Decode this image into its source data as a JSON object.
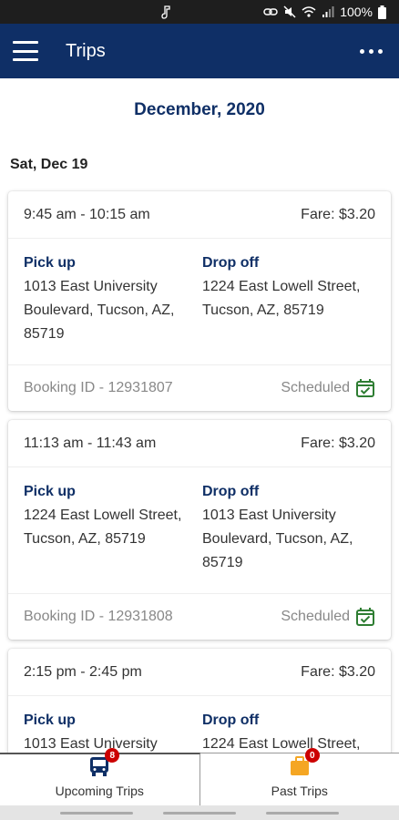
{
  "status_bar": {
    "battery": "100%"
  },
  "app_bar": {
    "title": "Trips"
  },
  "month": "December, 2020",
  "day": "Sat, Dec 19",
  "trips": [
    {
      "time": "9:45 am - 10:15 am",
      "fare": "Fare: $3.20",
      "pickup_label": "Pick up",
      "pickup_address": "1013 East University Boulevard, Tucson, AZ, 85719",
      "dropoff_label": "Drop off",
      "dropoff_address": "1224 East Lowell Street, Tucson, AZ, 85719",
      "booking": "Booking ID - 12931807",
      "status": "Scheduled"
    },
    {
      "time": "11:13 am - 11:43 am",
      "fare": "Fare: $3.20",
      "pickup_label": "Pick up",
      "pickup_address": "1224 East Lowell Street, Tucson, AZ, 85719",
      "dropoff_label": "Drop off",
      "dropoff_address": "1013 East University Boulevard, Tucson, AZ, 85719",
      "booking": "Booking ID - 12931808",
      "status": "Scheduled"
    },
    {
      "time": "2:15 pm - 2:45 pm",
      "fare": "Fare: $3.20",
      "pickup_label": "Pick up",
      "pickup_address": "1013 East University",
      "dropoff_label": "Drop off",
      "dropoff_address": "1224 East Lowell Street,"
    }
  ],
  "bottom_nav": {
    "upcoming": {
      "label": "Upcoming Trips",
      "badge": "8",
      "icon": "bus-icon"
    },
    "past": {
      "label": "Past Trips",
      "badge": "0",
      "icon": "briefcase-icon"
    }
  },
  "colors": {
    "primary": "#0f2f66",
    "status_green": "#2e7d32",
    "badge_red": "#cc0000",
    "past_icon": "#f5a623"
  }
}
